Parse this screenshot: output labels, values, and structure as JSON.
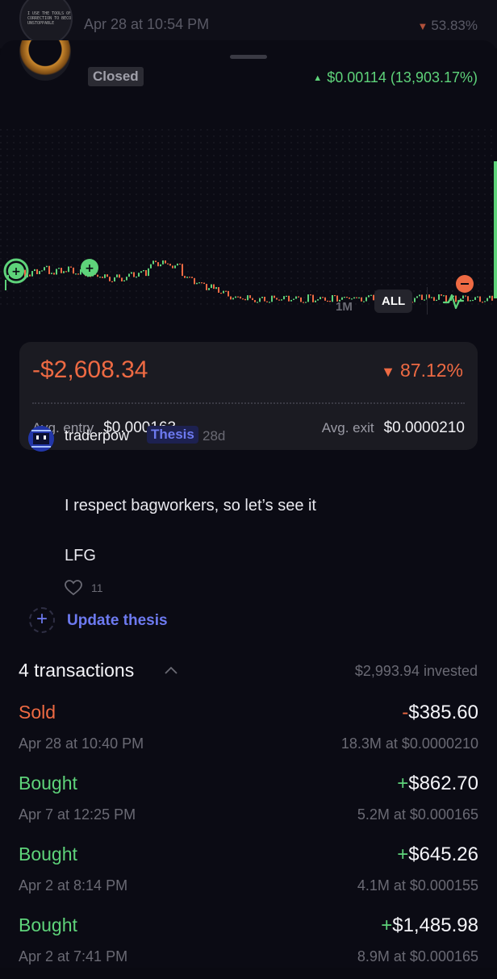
{
  "background_item": {
    "avatar_text": "I USE THE TOOLS OF\nCORRECTION TO BECOME\nUNSTOPPABLE",
    "date": "Apr 28 at 10:54 PM",
    "change": "53.83%"
  },
  "header": {
    "status": "Closed",
    "gain": "$0.00114 (13,903.17%)"
  },
  "chart_controls": {
    "range_1m": "1M",
    "range_all": "ALL",
    "selected": "ALL"
  },
  "pnl_card": {
    "pnl": "-$2,608.34",
    "pnl_pct": "87.12%",
    "avg_entry_label": "Avg. entry",
    "avg_entry": "$0.000163",
    "avg_exit_label": "Avg. exit",
    "avg_exit": "$0.0000210"
  },
  "comment": {
    "username": "traderpow",
    "tag": "Thesis",
    "age": "28d",
    "line1": "I respect bagworkers, so let’s see it",
    "line2": "LFG",
    "likes": "11",
    "update_label": "Update thesis"
  },
  "transactions": {
    "title": "4 transactions",
    "invested": "$2,993.94 invested",
    "items": [
      {
        "type": "Sold",
        "sign": "-",
        "amount": "$385.60",
        "date": "Apr 28 at 10:40 PM",
        "detail": "18.3M at $0.0000210"
      },
      {
        "type": "Bought",
        "sign": "+",
        "amount": "$862.70",
        "date": "Apr 7 at 12:25 PM",
        "detail": "5.2M at $0.000165"
      },
      {
        "type": "Bought",
        "sign": "+",
        "amount": "$645.26",
        "date": "Apr 2 at 8:14 PM",
        "detail": "4.1M at $0.000155"
      },
      {
        "type": "Bought",
        "sign": "+",
        "amount": "$1,485.98",
        "date": "Apr 2 at 7:41 PM",
        "detail": "8.9M at $0.000165"
      }
    ]
  },
  "colors": {
    "negative": "#ee6a43",
    "positive": "#5ed37a",
    "accent": "#6d7af0"
  },
  "icons": [
    "heart-icon",
    "plus-icon",
    "chevron-up-icon",
    "pulse-icon",
    "buy-marker-icon",
    "sell-marker-icon"
  ]
}
